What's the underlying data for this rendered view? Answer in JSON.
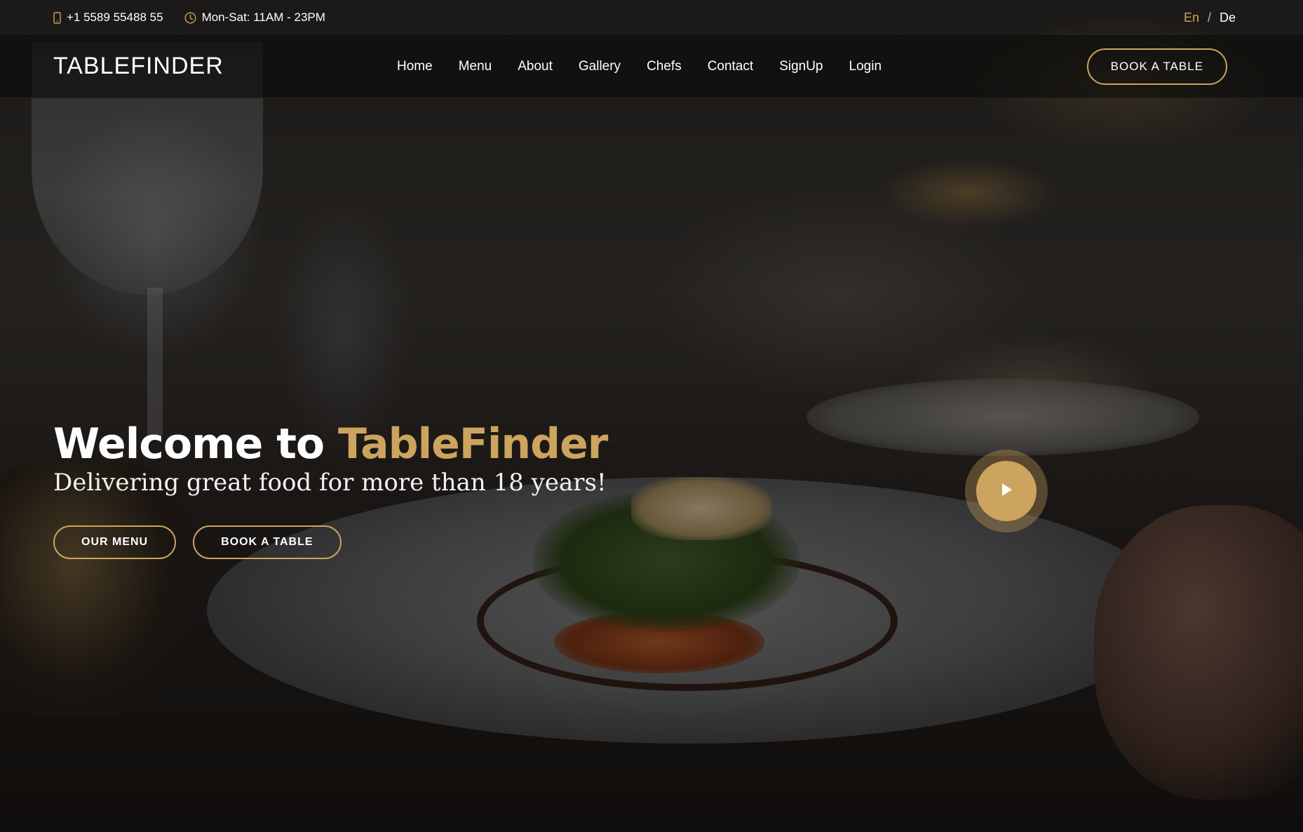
{
  "topbar": {
    "phone": "+1 5589 55488 55",
    "hours": "Mon-Sat: 11AM - 23PM",
    "phone_icon": "mobile-phone-icon",
    "hours_icon": "clock-icon",
    "languages": [
      "En",
      "De"
    ],
    "language_separator": "/",
    "active_language": "En"
  },
  "header": {
    "logo": "TABLEFINDER",
    "nav": [
      "Home",
      "Menu",
      "About",
      "Gallery",
      "Chefs",
      "Contact",
      "SignUp",
      "Login"
    ],
    "book_button": "BOOK A TABLE"
  },
  "hero": {
    "title_prefix": "Welcome to ",
    "title_brand": "TableFinder",
    "subtitle": "Delivering great food for more than 18 years!",
    "buttons": [
      "OUR MENU",
      "BOOK A TABLE"
    ],
    "play_icon": "play-icon"
  },
  "colors": {
    "accent": "#cda45e",
    "header_background": "#0c0b09",
    "text": "#ffffff"
  }
}
